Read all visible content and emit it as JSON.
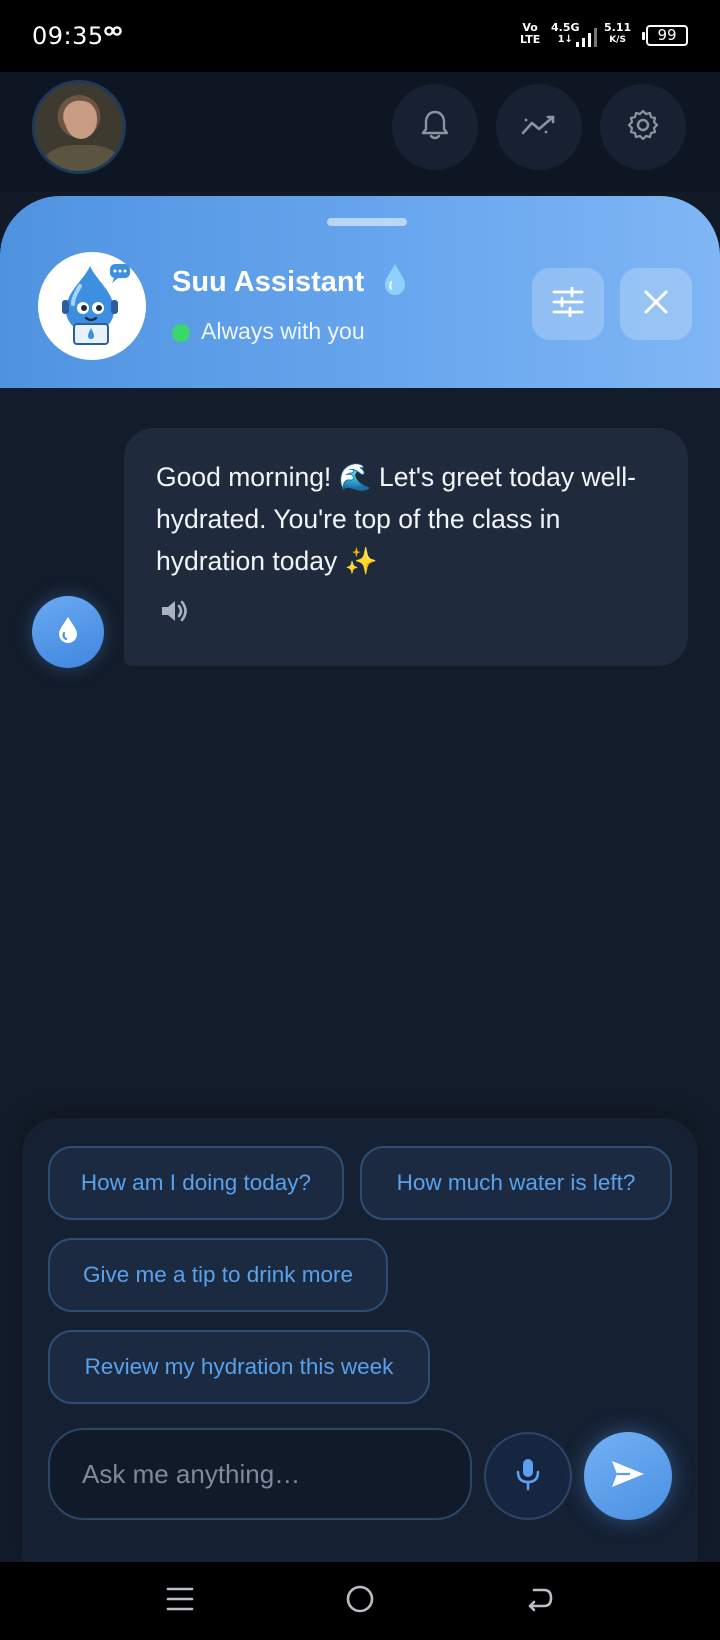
{
  "status_bar": {
    "time": "09:35",
    "network_volte": "Vo\nLTE",
    "network_type": "4.5G",
    "network_arrows": "1↓",
    "speed_value": "5.11",
    "speed_unit": "K/S",
    "battery": "99"
  },
  "header": {
    "buttons": [
      {
        "icon": "bell-icon"
      },
      {
        "icon": "trend-chart-icon"
      },
      {
        "icon": "gear-icon"
      }
    ]
  },
  "assistant": {
    "name": "Suu Assistant",
    "status": "Always with you",
    "status_color": "#38d66b",
    "accent": "#5a9be6"
  },
  "messages": [
    {
      "from": "assistant",
      "text": "Good morning! 🌊 Let's greet today well-hydrated. You're top of the class in hydration today ✨"
    }
  ],
  "suggestions": [
    "How am I doing today?",
    "How much water is left?",
    "Give me a tip to drink more",
    "Review my hydration this week"
  ],
  "composer": {
    "placeholder": "Ask me anything…"
  },
  "nav": {
    "icons": [
      "menu-icon",
      "home-icon",
      "back-icon"
    ]
  }
}
